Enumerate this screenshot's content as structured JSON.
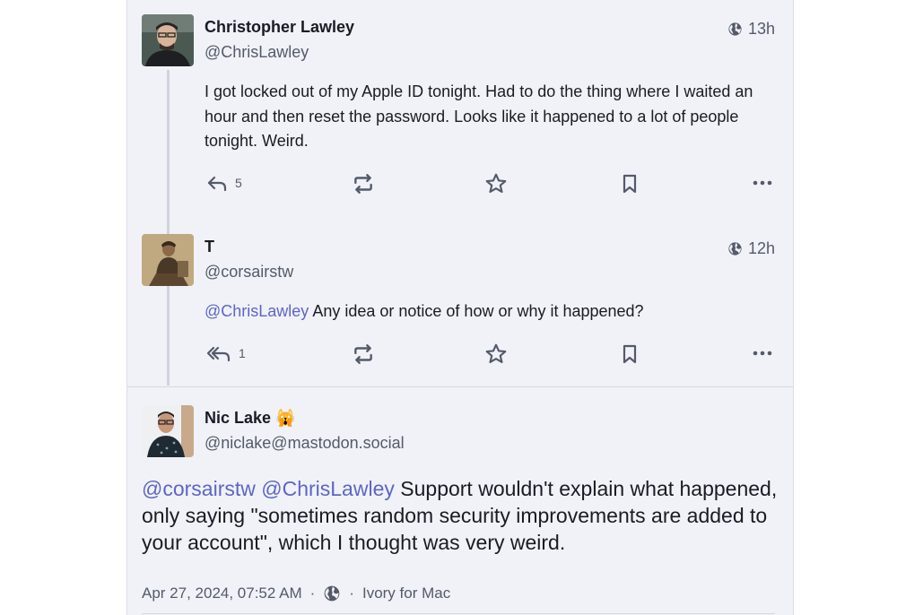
{
  "posts": [
    {
      "name": "Christopher Lawley",
      "handle": "@ChrisLawley",
      "time": "13h",
      "text": "I got locked out of my Apple ID tonight. Had to do the thing where I waited an hour and then reset the password. Looks like it happened to a lot of people tonight. Weird.",
      "reply_count": "5",
      "icons": {
        "visibility": "globe-icon",
        "reply": "reply-icon",
        "boost": "boost-icon",
        "favourite": "star-icon",
        "bookmark": "bookmark-icon",
        "more": "more-icon"
      }
    },
    {
      "name": "T",
      "handle": "@corsairstw",
      "time": "12h",
      "mention": "@ChrisLawley",
      "text": "Any idea or notice of how or why it happened?",
      "reply_count": "1",
      "icons": {
        "visibility": "globe-icon",
        "reply": "reply-all-icon",
        "boost": "boost-icon",
        "favourite": "star-icon",
        "bookmark": "bookmark-icon",
        "more": "more-icon"
      }
    }
  ],
  "focused_post": {
    "name": "Nic Lake",
    "emoji": "🙀",
    "handle": "@niclake@mastodon.social",
    "mention_1": "@corsairstw",
    "mention_2": "@ChrisLawley",
    "text": "Support wouldn't explain what happened, only saying \"sometimes random security improvements are added to your account\", which I thought was very weird.",
    "date": "Apr 27, 2024, 07:52 AM",
    "separator": "·",
    "app": "Ivory for Mac"
  },
  "colors": {
    "mention": "#5d66c6",
    "muted": "#545a6a",
    "background": "#f0f2f7"
  }
}
